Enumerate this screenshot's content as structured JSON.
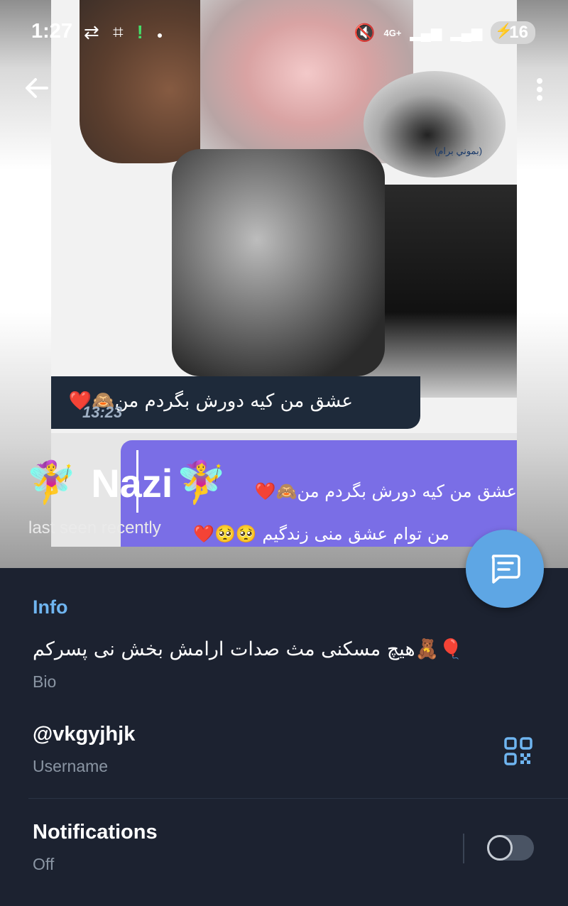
{
  "status_bar": {
    "time": "1:27",
    "battery": "16",
    "network": "4G+"
  },
  "chat_photo": {
    "bubble1_text": "عشق من کیه دورش بگردم من🙈❤️",
    "bubble1_time": "13:23",
    "bubble2_line1": "عشق من کیه دورش بگردم من🙈❤️",
    "bubble2_line2": "من توام عشق منی زندگیم 🥺🥺❤️",
    "caption": "(بموني برام)"
  },
  "profile": {
    "name": "Nazi",
    "status": "last seen recently",
    "fairy_emoji": "🧚‍♀️"
  },
  "info": {
    "section_title": "Info",
    "bio": "هیچ مسکنی مث صدات ارامش بخش نی پسرکم🧸🎈",
    "bio_label": "Bio",
    "username": "@vkgyjhjk",
    "username_label": "Username",
    "notifications_label": "Notifications",
    "notifications_value": "Off"
  },
  "colors": {
    "accent": "#5ea6e4",
    "panel_bg": "#1c2230",
    "section_title": "#6fb5f0"
  },
  "icons": [
    "back-arrow-icon",
    "more-vert-icon",
    "message-icon",
    "qr-code-icon",
    "mute-icon",
    "signal-icon",
    "battery-icon"
  ]
}
